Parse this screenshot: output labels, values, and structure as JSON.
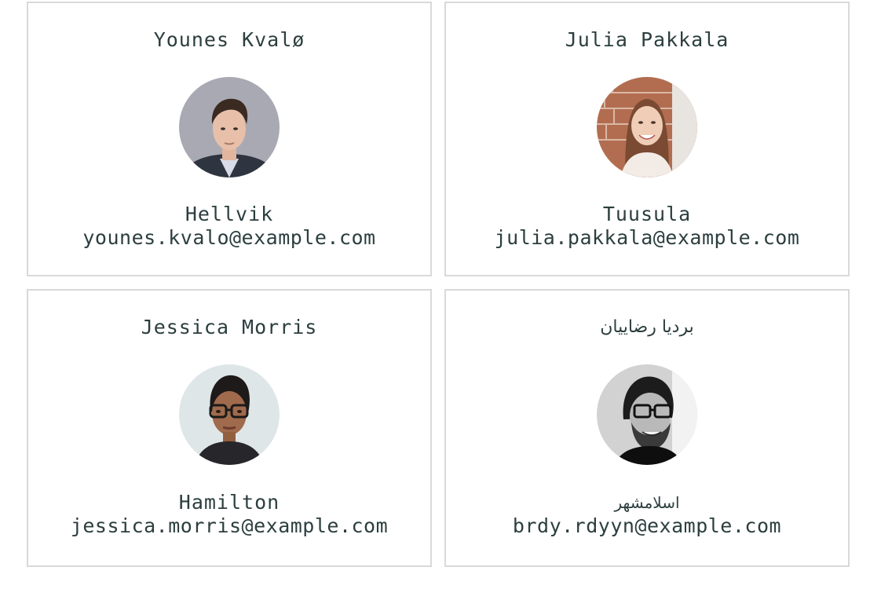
{
  "users": [
    {
      "name": "Younes Kvalø",
      "city": "Hellvik",
      "email": "younes.kvalo@example.com",
      "avatar_icon": "portrait-man-suit"
    },
    {
      "name": "Julia Pakkala",
      "city": "Tuusula",
      "email": "julia.pakkala@example.com",
      "avatar_icon": "portrait-woman-brick-wall"
    },
    {
      "name": "Jessica Morris",
      "city": "Hamilton",
      "email": "jessica.morris@example.com",
      "avatar_icon": "portrait-woman-glasses"
    },
    {
      "name": "بردیا رضاییان",
      "city": "اسلامشهر",
      "email": "brdy.rdyyn@example.com",
      "avatar_icon": "portrait-man-glasses-bw"
    }
  ],
  "colors": {
    "text": "#2c3e3e",
    "border": "#d9d9d9",
    "background": "#ffffff"
  }
}
